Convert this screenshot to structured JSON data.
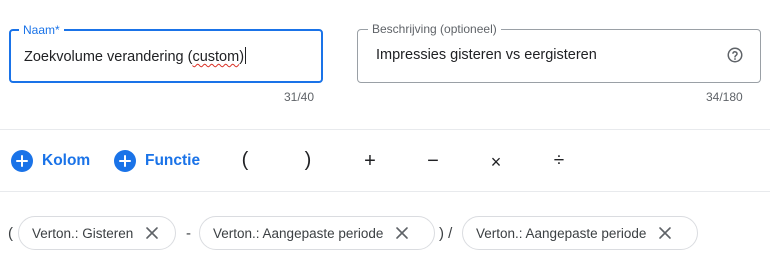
{
  "name_field": {
    "label": "Naam*",
    "value_plain": "Zoekvolume verandering (",
    "value_misspelled": "custom",
    "value_end": ")",
    "counter": "31/40"
  },
  "description_field": {
    "label": "Beschrijving (optioneel)",
    "value": "Impressies gisteren vs eergisteren",
    "counter": "34/180",
    "icon": "help-circle-icon"
  },
  "toolbar": {
    "column_label": "Kolom",
    "function_label": "Functie",
    "open_paren": "(",
    "close_paren": ")",
    "plus": "+",
    "minus": "−",
    "times": "×",
    "divide": "÷"
  },
  "formula": {
    "open_paren": "(",
    "chip_1": "Verton.: Gisteren",
    "operator_1": "-",
    "chip_2": "Verton.: Aangepaste periode",
    "close_paren_divide": ") /",
    "chip_3": "Verton.: Aangepaste periode"
  },
  "colors": {
    "accent": "#1a73e8",
    "spellcheck": "#d93025",
    "border": "#dadce0"
  }
}
